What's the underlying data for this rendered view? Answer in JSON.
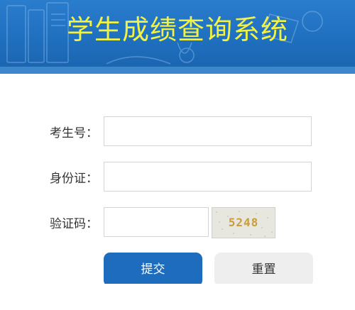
{
  "banner": {
    "title": "学生成绩查询系统"
  },
  "form": {
    "exam_no_label": "考生号：",
    "exam_no_value": "",
    "id_label": "身份证：",
    "id_value": "",
    "captcha_label": "验证码：",
    "captcha_value": "",
    "captcha_image_text": "5248"
  },
  "buttons": {
    "submit": "提交",
    "reset": "重置"
  },
  "colors": {
    "banner_blue": "#1f6fbf",
    "title_yellow": "#f2f244",
    "submit_blue": "#1e6cbd",
    "reset_gray": "#eeeeee"
  }
}
